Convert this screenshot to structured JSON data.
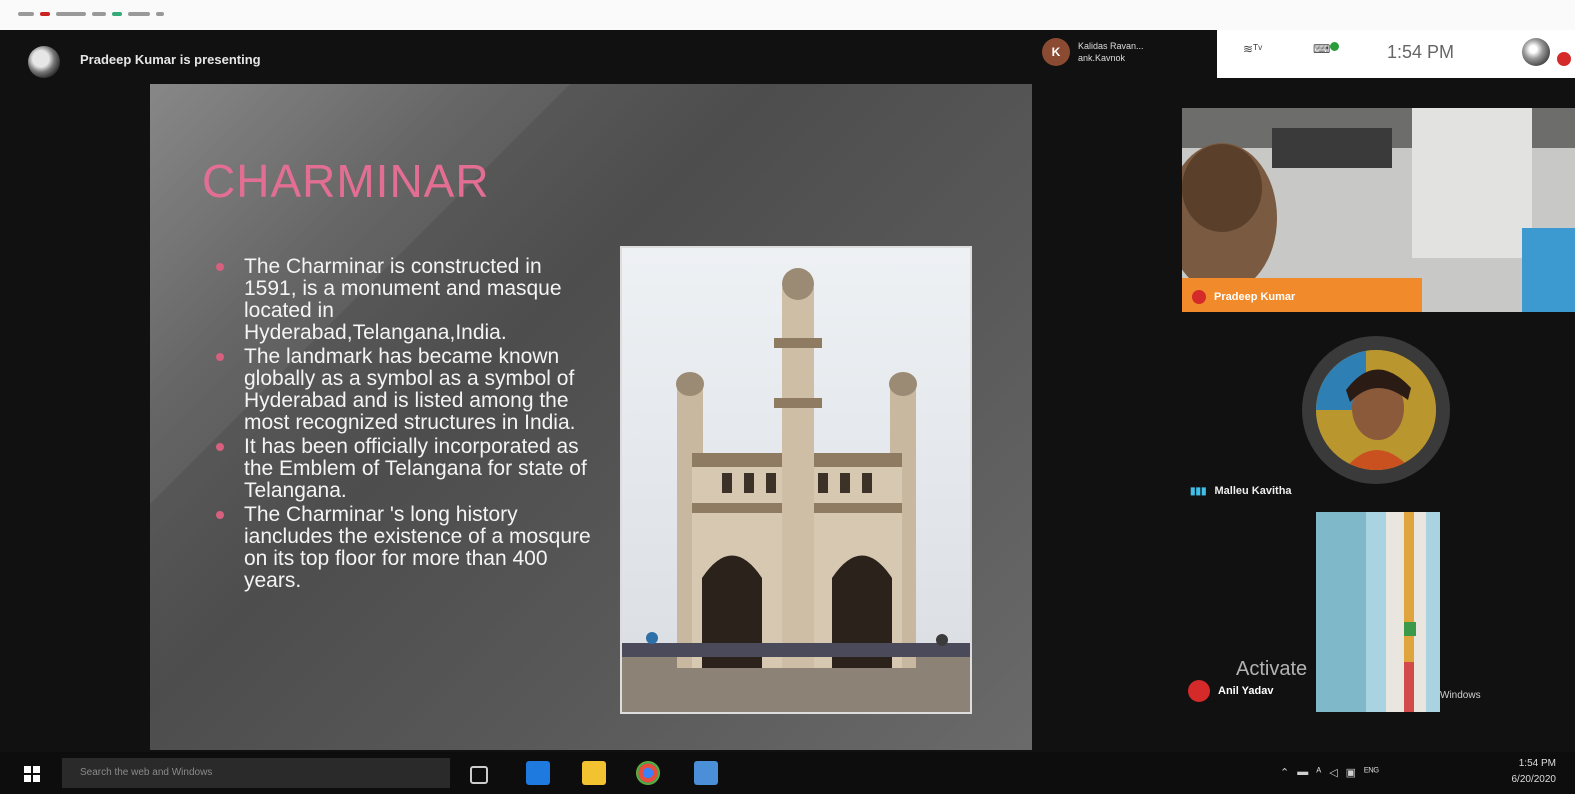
{
  "meet": {
    "presenting_text": "Pradeep Kumar is presenting",
    "account_initial": "K",
    "account_name": "Kalidas Ravan...",
    "account_sub": "ank.Kavnok",
    "status_icons": [
      "signal-icon",
      "notification-icon"
    ],
    "time": "1:54 PM"
  },
  "slide": {
    "title": "CHARMINAR",
    "bullets": [
      "The Charminar is constructed in 1591, is a monument and masque located in Hyderabad,Telangana,India.",
      "The landmark has became known globally as a symbol as a symbol of Hyderabad and is listed among the most recognized structures in India.",
      "It has been officially incorporated as the Emblem of Telangana for state of Telangana.",
      "The Charminar 's long history iancludes the existence of a mosqure on its top floor for more than 400 years."
    ]
  },
  "participants": [
    {
      "name": "Pradeep Kumar",
      "status_icon": "mic-off-icon"
    },
    {
      "name": "Malleu Kavitha",
      "status_icon": "speaking-icon"
    },
    {
      "name": "Anil Yadav",
      "status_icon": "mic-off-icon"
    }
  ],
  "watermark": {
    "activate": "Activate",
    "activate_sub": "Windows"
  },
  "taskbar": {
    "search_placeholder": "Search the web and Windows",
    "clock_time": "1:54 PM",
    "clock_date": "6/20/2020"
  },
  "colors": {
    "title_pink": "#e26f93",
    "bullet_pink": "#d8607f",
    "mute_red": "#d42a2a"
  }
}
